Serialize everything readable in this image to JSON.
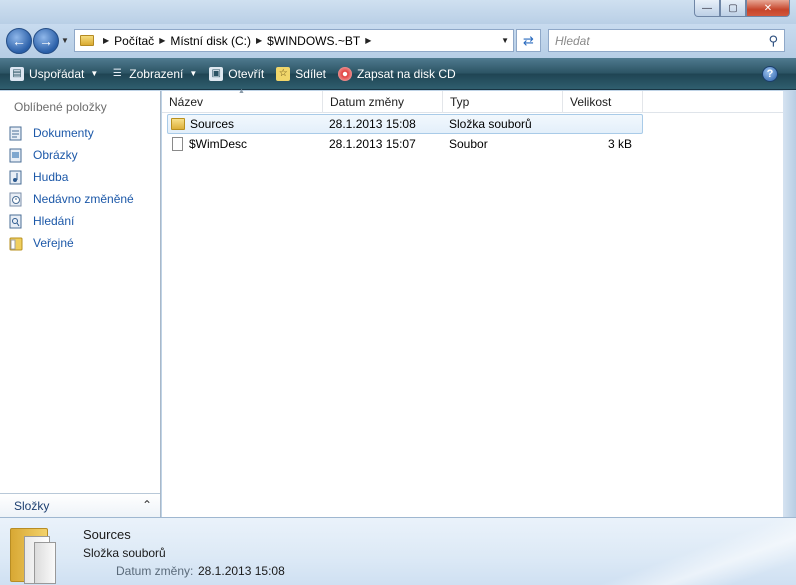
{
  "window": {
    "minimize_glyph": "—",
    "maximize_glyph": "▢",
    "close_glyph": "✕"
  },
  "address": {
    "crumbs": [
      "Počítač",
      "Místní disk (C:)",
      "$WINDOWS.~BT"
    ],
    "search_placeholder": "Hledat"
  },
  "toolbar": {
    "organize": "Uspořádat",
    "views": "Zobrazení",
    "open": "Otevřít",
    "share": "Sdílet",
    "burn": "Zapsat na disk CD"
  },
  "navpane": {
    "heading": "Oblíbené položky",
    "favorites": [
      {
        "label": "Dokumenty",
        "icon": "documents-icon"
      },
      {
        "label": "Obrázky",
        "icon": "pictures-icon"
      },
      {
        "label": "Hudba",
        "icon": "music-icon"
      },
      {
        "label": "Nedávno změněné",
        "icon": "recent-icon"
      },
      {
        "label": "Hledání",
        "icon": "search-folder-icon"
      },
      {
        "label": "Veřejné",
        "icon": "public-folder-icon"
      }
    ],
    "folders_label": "Složky"
  },
  "filelist": {
    "columns": [
      "Název",
      "Datum změny",
      "Typ",
      "Velikost"
    ],
    "rows": [
      {
        "name": "Sources",
        "date": "28.1.2013 15:08",
        "type": "Složka souborů",
        "size": "",
        "icon": "folder-icon",
        "selected": true
      },
      {
        "name": "$WimDesc",
        "date": "28.1.2013 15:07",
        "type": "Soubor",
        "size": "3 kB",
        "icon": "file-icon",
        "selected": false
      }
    ]
  },
  "details": {
    "name": "Sources",
    "type": "Složka souborů",
    "date_label": "Datum změny:",
    "date_value": "28.1.2013 15:08"
  },
  "colors": {
    "link_blue": "#1c58a8",
    "command_bar": "#2b5363",
    "selection": "#e3effa"
  }
}
